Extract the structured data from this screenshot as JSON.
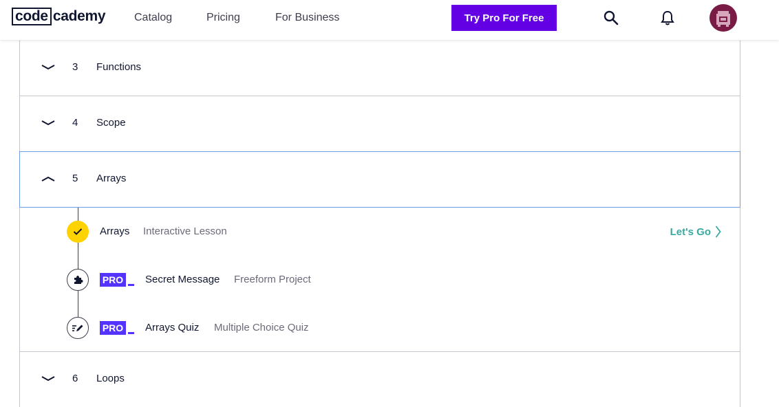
{
  "nav": {
    "logo_box": "code",
    "logo_rest": "cademy",
    "links": [
      "Catalog",
      "Pricing",
      "For Business"
    ],
    "cta": "Try Pro For Free",
    "icons": [
      "search-icon",
      "bell-icon"
    ],
    "colors": {
      "cta": "#6400e4",
      "avatar": "#7a1b45"
    }
  },
  "modules": [
    {
      "num": "3",
      "title": "Functions",
      "state": "collapsed"
    },
    {
      "num": "4",
      "title": "Scope",
      "state": "collapsed"
    },
    {
      "num": "5",
      "title": "Arrays",
      "state": "expanded"
    },
    {
      "num": "6",
      "title": "Loops",
      "state": "collapsed"
    }
  ],
  "lessons": [
    {
      "title": "Arrays",
      "type": "Interactive Lesson",
      "status": "complete",
      "icon": "check-icon",
      "action": "Let's Go"
    },
    {
      "badge": "PRO",
      "title": "Secret Message",
      "type": "Freeform Project",
      "icon": "puzzle-icon"
    },
    {
      "badge": "PRO",
      "title": "Arrays Quiz",
      "type": "Multiple Choice Quiz",
      "icon": "quiz-pencil-icon"
    }
  ],
  "colors": {
    "complete": "#ffd300",
    "pro": "#5533ff",
    "action": "#3aa9a0",
    "focus": "#6d9ce8"
  }
}
